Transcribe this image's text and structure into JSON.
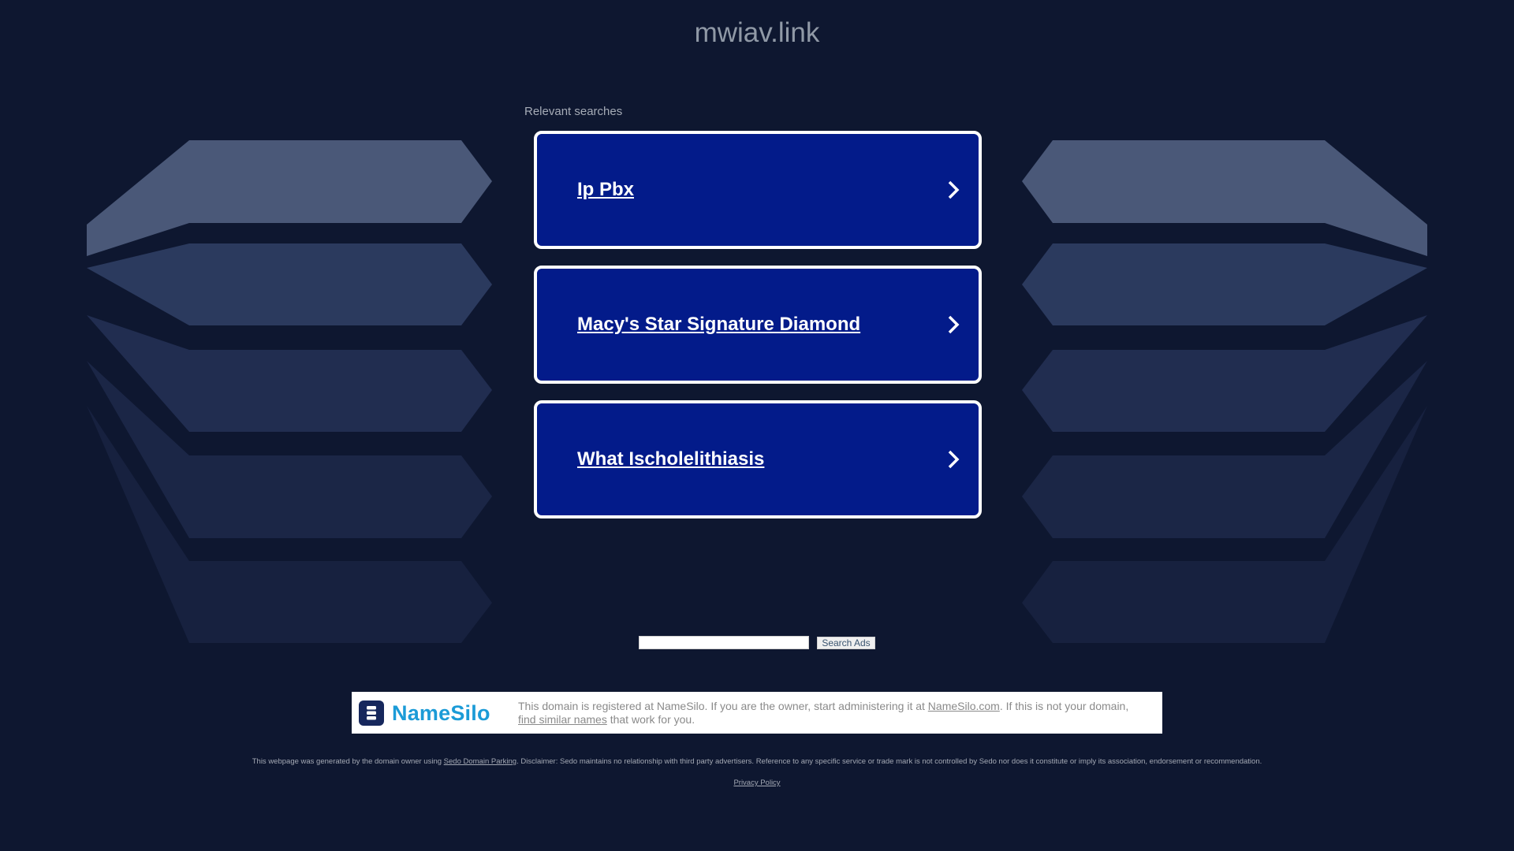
{
  "page": {
    "domain_title": "mwiav.link",
    "relevant_label": "Relevant searches"
  },
  "cards": [
    {
      "label": "Ip Pbx"
    },
    {
      "label": "Macy's Star Signature Diamond"
    },
    {
      "label": "What Ischolelithiasis"
    }
  ],
  "search": {
    "input_value": "",
    "button_label": "Search Ads"
  },
  "registrar": {
    "logo_text": "NameSilo",
    "text_part1": "This domain is registered at NameSilo. If you are the owner, start administering it at ",
    "link1": "NameSilo.com",
    "text_part2": ". If this is not your domain, ",
    "link2": "find similar names",
    "text_part3": " that work for you."
  },
  "disclaimer": {
    "part1": "This webpage was generated by the domain owner using ",
    "link": "Sedo Domain Parking",
    "part2": ". Disclaimer: Sedo maintains no relationship with third party advertisers. Reference to any specific service or trade mark is not controlled by Sedo nor does it constitute or imply its association, endorsement or recommendation."
  },
  "privacy": {
    "label": "Privacy Policy"
  },
  "colors": {
    "background": "#0e1730",
    "card_fill": "#031b8a",
    "card_border": "#ffffff",
    "shape_light": "#4a5878",
    "shape_mid": "#2b3a5e",
    "shape_dark": "#1b2646",
    "namesilo_blue": "#1b9bd7",
    "namesilo_navy": "#16275c"
  }
}
